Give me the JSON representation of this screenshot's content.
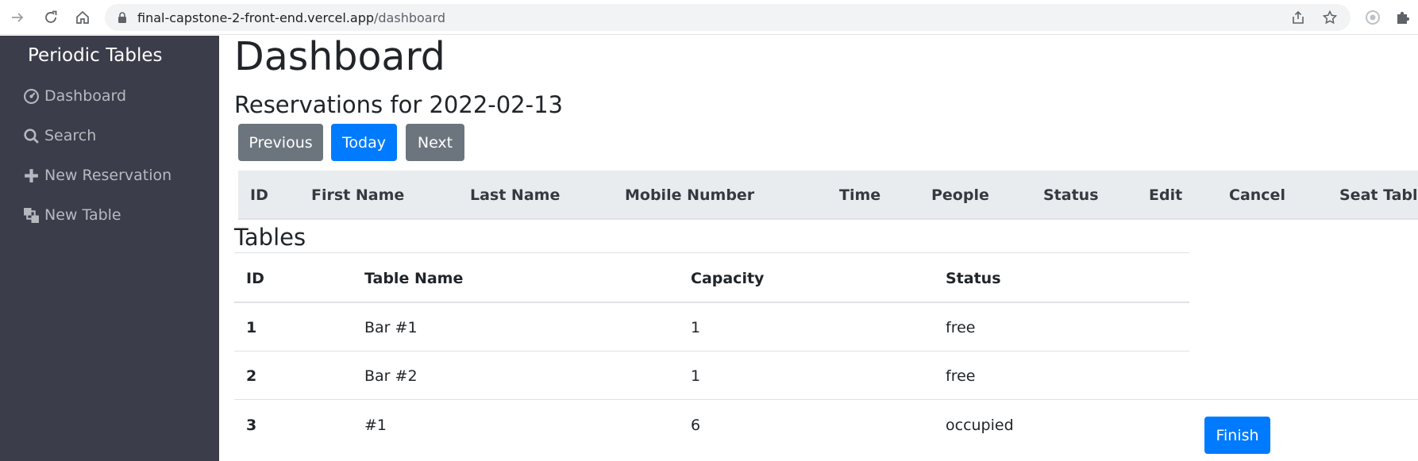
{
  "browser": {
    "url_host": "final-capstone-2-front-end.vercel.app",
    "url_path": "/dashboard",
    "icons": [
      "forward-arrow-icon",
      "reload-icon",
      "home-icon",
      "lock-icon",
      "share-icon",
      "star-icon",
      "extension-icon",
      "puzzle-icon"
    ]
  },
  "sidebar": {
    "brand": "Periodic Tables",
    "items": [
      {
        "label": "Dashboard",
        "icon": "dashboard-icon"
      },
      {
        "label": "Search",
        "icon": "search-icon"
      },
      {
        "label": "New Reservation",
        "icon": "plus-icon"
      },
      {
        "label": "New Table",
        "icon": "layers-icon"
      }
    ]
  },
  "main": {
    "title": "Dashboard",
    "subtitle": "Reservations for 2022-02-13",
    "buttons": {
      "previous": "Previous",
      "today": "Today",
      "next": "Next"
    },
    "reservations": {
      "columns": [
        "ID",
        "First Name",
        "Last Name",
        "Mobile Number",
        "Time",
        "People",
        "Status",
        "Edit",
        "Cancel",
        "Seat Table"
      ],
      "rows": []
    },
    "tables": {
      "title": "Tables",
      "columns": [
        "ID",
        "Table Name",
        "Capacity",
        "Status"
      ],
      "rows": [
        {
          "id": "1",
          "name": "Bar #1",
          "capacity": "1",
          "status": "free"
        },
        {
          "id": "2",
          "name": "Bar #2",
          "capacity": "1",
          "status": "free"
        },
        {
          "id": "3",
          "name": "#1",
          "capacity": "6",
          "status": "occupied",
          "action": "Finish"
        }
      ]
    }
  },
  "colors": {
    "sidebar_bg": "#3b3d4b",
    "primary": "#007bff",
    "secondary": "#6c757d",
    "table_head_bg": "#e9ecef"
  }
}
